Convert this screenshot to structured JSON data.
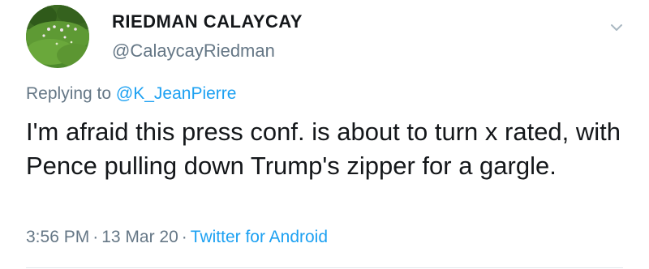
{
  "tweet": {
    "author": {
      "display_name": "RIEDMAN CALAYCAY",
      "handle": "@CalaycayRiedman",
      "avatar": "avatar-photo-garden"
    },
    "menu_icon": "chevron-down-icon",
    "replying_prefix": "Replying to",
    "replying_to": "@K_JeanPierre",
    "text": "I'm afraid this press conf. is about to turn x rated, with Pence pulling down Trump's zipper for a gargle.",
    "time": "3:56 PM",
    "date": "13 Mar 20",
    "separator": "·",
    "source": "Twitter for Android"
  },
  "colors": {
    "text_primary": "#14171a",
    "text_secondary": "#657786",
    "link": "#1da1f2",
    "divider": "#e1e8ed"
  }
}
